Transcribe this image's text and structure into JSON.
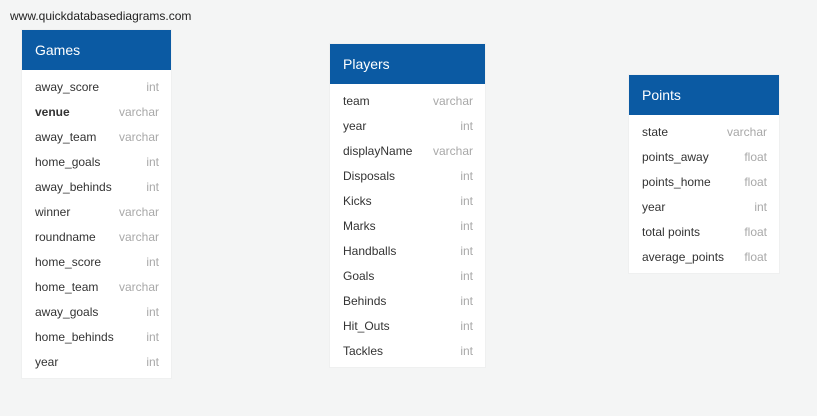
{
  "watermark": "www.quickdatabasediagrams.com",
  "tables": {
    "games": {
      "title": "Games",
      "fields": [
        {
          "name": "away_score",
          "type": "int"
        },
        {
          "name": "venue",
          "type": "varchar"
        },
        {
          "name": "away_team",
          "type": "varchar"
        },
        {
          "name": "home_goals",
          "type": "int"
        },
        {
          "name": "away_behinds",
          "type": "int"
        },
        {
          "name": "winner",
          "type": "varchar"
        },
        {
          "name": "roundname",
          "type": "varchar"
        },
        {
          "name": "home_score",
          "type": "int"
        },
        {
          "name": "home_team",
          "type": "varchar"
        },
        {
          "name": "away_goals",
          "type": "int"
        },
        {
          "name": "home_behinds",
          "type": "int"
        },
        {
          "name": "year",
          "type": "int"
        }
      ]
    },
    "players": {
      "title": "Players",
      "fields": [
        {
          "name": "team",
          "type": "varchar"
        },
        {
          "name": "year",
          "type": "int"
        },
        {
          "name": "displayName",
          "type": "varchar"
        },
        {
          "name": "Disposals",
          "type": "int"
        },
        {
          "name": "Kicks",
          "type": "int"
        },
        {
          "name": "Marks",
          "type": "int"
        },
        {
          "name": "Handballs",
          "type": "int"
        },
        {
          "name": "Goals",
          "type": "int"
        },
        {
          "name": "Behinds",
          "type": "int"
        },
        {
          "name": "Hit_Outs",
          "type": "int"
        },
        {
          "name": "Tackles",
          "type": "int"
        }
      ]
    },
    "points": {
      "title": "Points",
      "fields": [
        {
          "name": "state",
          "type": "varchar"
        },
        {
          "name": "points_away",
          "type": "float"
        },
        {
          "name": "points_home",
          "type": "float"
        },
        {
          "name": "year",
          "type": "int"
        },
        {
          "name": "total points",
          "type": "float"
        },
        {
          "name": "average_points",
          "type": "float"
        }
      ]
    }
  }
}
